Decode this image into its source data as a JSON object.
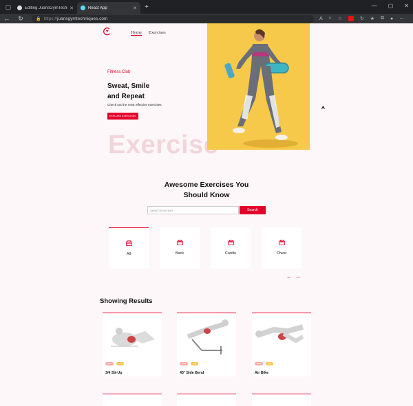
{
  "browser": {
    "tabs": [
      {
        "label": "Editing JuansGymTechniques/RE",
        "active": false
      },
      {
        "label": "React App",
        "active": true
      }
    ],
    "url_scheme": "https://",
    "url_host": "juansgymtechniques.com"
  },
  "nav": {
    "home": "Home",
    "exercises": "Exercises"
  },
  "hero": {
    "club": "Fitness Club",
    "headline_line1": "Sweat, Smile",
    "headline_line2": "and Repeat",
    "subline": "Check out the most effective exercises",
    "cta": "EXPLORE EXERCISES",
    "watermark": "Exercise"
  },
  "search": {
    "title_line1": "Awesome Exercises You",
    "title_line2": "Should Know",
    "placeholder": "Search Exercises",
    "button": "Search"
  },
  "categories": [
    {
      "label": "All",
      "selected": true
    },
    {
      "label": "Back",
      "selected": false
    },
    {
      "label": "Cardio",
      "selected": false
    },
    {
      "label": "Chest",
      "selected": false
    }
  ],
  "results": {
    "title": "Showing Results",
    "cards": [
      {
        "name": "3/4 Sit-Up",
        "tag1": "Waist",
        "tag2": "Abs"
      },
      {
        "name": "45° Side Bend",
        "tag1": "Waist",
        "tag2": "Abs"
      },
      {
        "name": "Air Bike",
        "tag1": "Waist",
        "tag2": "Abs"
      }
    ]
  },
  "colors": {
    "accent": "#e3002b",
    "hero_bg": "#f6c94a",
    "tag_pink": "#ffa9a9",
    "tag_yellow": "#fcc757"
  }
}
